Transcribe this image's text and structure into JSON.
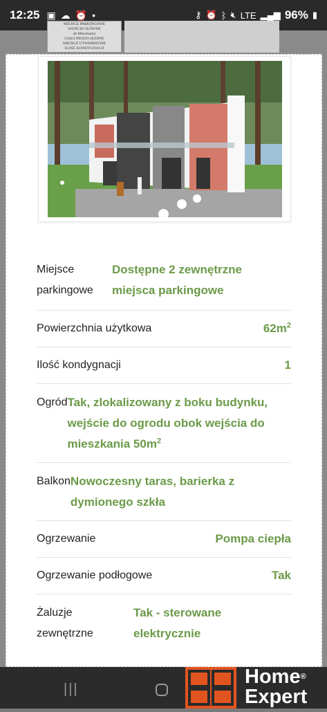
{
  "status_bar": {
    "time": "12:25",
    "battery": "96%",
    "network": "LTE"
  },
  "background_doc": {
    "lines": [
      "MIEJSCE PARKINGOWE",
      "WEJŚCIE GŁÓWNE",
      "do Mieszkania",
      "CIĄGI PIESZO-JEZDNE",
      "MIEJSCE UTWARDZONE",
      "ILOŚĆ KONDYGNACJI"
    ]
  },
  "details": {
    "parking_label_1": "Miejsce",
    "parking_label_2": "parkingowe",
    "parking_value_1": "Dostępne 2 zewnętrzne",
    "parking_value_2": "miejsca parkingowe",
    "area_label": "Powierzchnia użytkowa",
    "area_value": "62m",
    "area_unit_sup": "2",
    "floors_label": "Ilość kondygnacji",
    "floors_value": "1",
    "garden_label": "Ogród",
    "garden_value_1": "Tak, zlokalizowany z boku budynku,",
    "garden_value_2": "wejście do ogrodu obok wejścia do",
    "garden_value_3": "mieszkania 50m",
    "garden_unit_sup": "2",
    "balcony_label": "Balkon",
    "balcony_value_1": "Nowoczesny taras, barierka z",
    "balcony_value_2": "dymionego szkła",
    "heating_label": "Ogrzewanie",
    "heating_value": "Pompa ciepła",
    "floor_heating_label": "Ogrzewanie podłogowe",
    "floor_heating_value": "Tak",
    "blinds_label_1": "Żaluzje",
    "blinds_label_2": "zewnętrzne",
    "blinds_value_1": "Tak - sterowane",
    "blinds_value_2": "elektrycznie"
  },
  "logo": {
    "line1": "Home",
    "line2": "Expert",
    "reg": "®",
    "brand_color": "#e2541f"
  },
  "colors": {
    "value_green": "#6b9a48"
  }
}
